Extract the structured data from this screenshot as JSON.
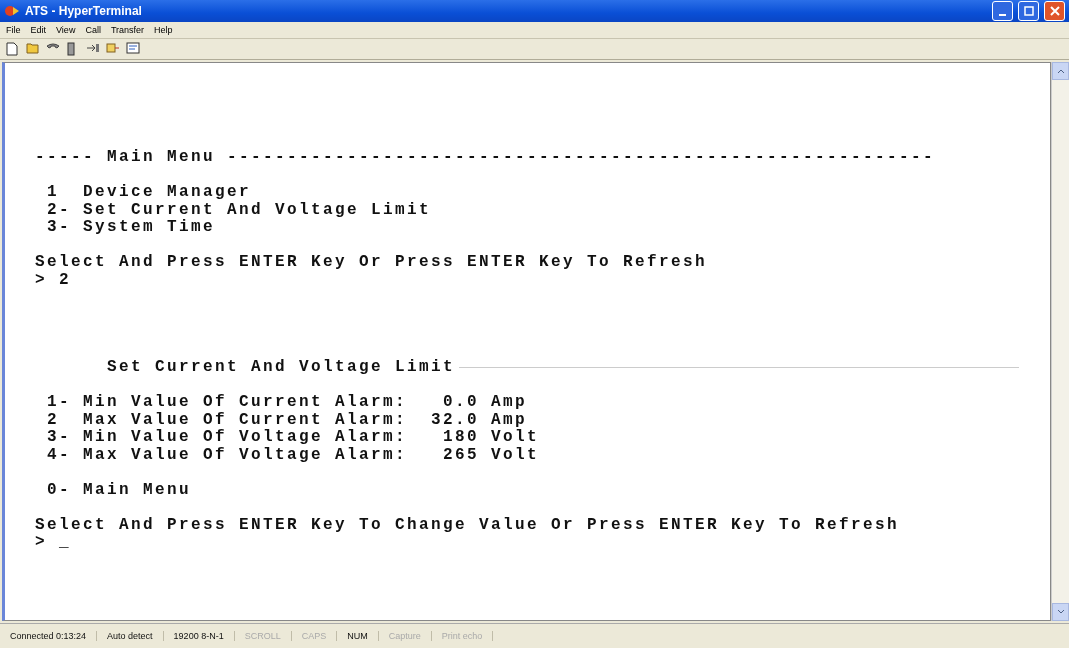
{
  "window": {
    "title": "ATS - HyperTerminal"
  },
  "menu": [
    "File",
    "Edit",
    "View",
    "Call",
    "Transfer",
    "Help"
  ],
  "toolbar": [
    {
      "kind": "new"
    },
    {
      "kind": "open"
    },
    {
      "kind": "phone"
    },
    {
      "kind": "hangup"
    },
    {
      "kind": "send"
    },
    {
      "kind": "receive"
    },
    {
      "kind": "properties"
    }
  ],
  "terminal": {
    "lines": [
      {
        "kind": "text",
        "text": "----- Main Menu -----------------------------------------------------------"
      },
      {
        "kind": "blank"
      },
      {
        "kind": "text",
        "text": " 1  Device Manager"
      },
      {
        "kind": "text",
        "text": " 2- Set Current And Voltage Limit"
      },
      {
        "kind": "text",
        "text": " 3- System Time"
      },
      {
        "kind": "blank"
      },
      {
        "kind": "text",
        "text": "Select And Press ENTER Key Or Press ENTER Key To Refresh"
      },
      {
        "kind": "text",
        "text": "> 2"
      },
      {
        "kind": "blank"
      },
      {
        "kind": "blank"
      },
      {
        "kind": "blank"
      },
      {
        "kind": "blank"
      },
      {
        "kind": "section",
        "text": "      Set Current And Voltage Limit"
      },
      {
        "kind": "blank"
      },
      {
        "kind": "text",
        "text": " 1- Min Value Of Current Alarm:   0.0 Amp"
      },
      {
        "kind": "text",
        "text": " 2  Max Value Of Current Alarm:  32.0 Amp"
      },
      {
        "kind": "text",
        "text": " 3- Min Value Of Voltage Alarm:   180 Volt"
      },
      {
        "kind": "text",
        "text": " 4- Max Value Of Voltage Alarm:   265 Volt"
      },
      {
        "kind": "blank"
      },
      {
        "kind": "text",
        "text": " 0- Main Menu"
      },
      {
        "kind": "blank"
      },
      {
        "kind": "text",
        "text": "Select And Press ENTER Key To Change Value Or Press ENTER Key To Refresh"
      },
      {
        "kind": "text",
        "text": "> _"
      }
    ]
  },
  "status_bar": [
    {
      "text": "Connected 0:13:24",
      "disabled": false
    },
    {
      "text": "Auto detect",
      "disabled": false
    },
    {
      "text": "19200 8-N-1",
      "disabled": false
    },
    {
      "text": "SCROLL",
      "disabled": true
    },
    {
      "text": "CAPS",
      "disabled": true
    },
    {
      "text": "NUM",
      "disabled": false
    },
    {
      "text": "Capture",
      "disabled": true
    },
    {
      "text": "Print echo",
      "disabled": true
    }
  ]
}
